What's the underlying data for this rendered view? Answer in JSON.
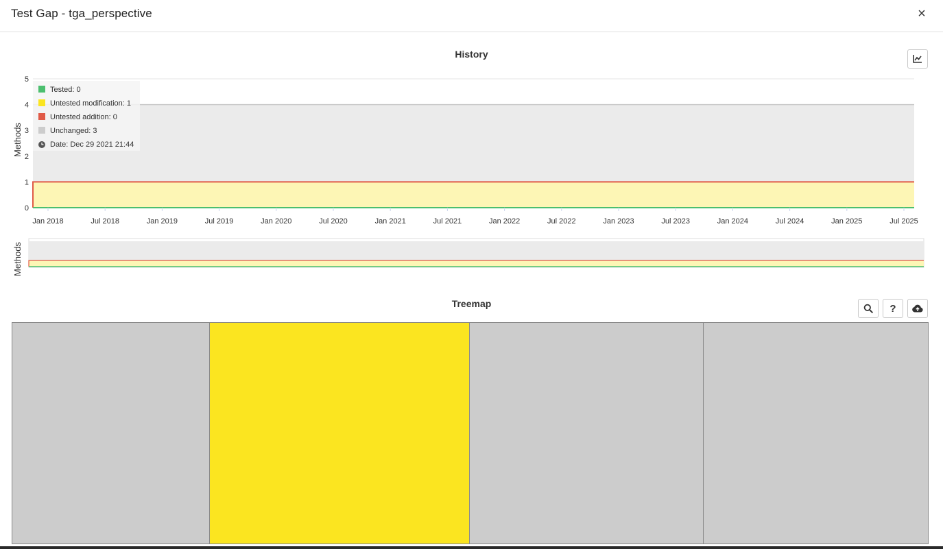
{
  "dialog": {
    "title": "Test Gap - tga_perspective",
    "close_icon": "×"
  },
  "history": {
    "title": "History",
    "tooltip": {
      "rows": [
        {
          "label": "Tested: 0",
          "color": "#4cbf6f"
        },
        {
          "label": "Untested modification: 1",
          "color": "#fbe520"
        },
        {
          "label": "Untested addition: 0",
          "color": "#e05a47"
        },
        {
          "label": "Unchanged: 3",
          "color": "#cccccc"
        }
      ],
      "date": "Date: Dec 29 2021 21:44"
    }
  },
  "chart_data": {
    "type": "area",
    "title": "History",
    "xlabel": "",
    "ylabel": "Methods",
    "ylim": [
      0,
      5
    ],
    "yticks": [
      "0",
      "1",
      "2",
      "3",
      "4",
      "5"
    ],
    "xticks": [
      "Jan 2018",
      "Jul 2018",
      "Jan 2019",
      "Jul 2019",
      "Jan 2020",
      "Jul 2020",
      "Jan 2021",
      "Jul 2021",
      "Jan 2022",
      "Jul 2022",
      "Jan 2023",
      "Jul 2023",
      "Jan 2024",
      "Jul 2024",
      "Jan 2025",
      "Jul 2025"
    ],
    "stacked": true,
    "grid": true,
    "series": [
      {
        "name": "Tested",
        "color": "#4cbf6f",
        "values": [
          0,
          0
        ]
      },
      {
        "name": "Untested modification",
        "color": "#fbe520",
        "values": [
          1,
          1
        ]
      },
      {
        "name": "Untested addition",
        "color": "#e05a47",
        "values": [
          0,
          0
        ]
      },
      {
        "name": "Unchanged",
        "color": "#cccccc",
        "values": [
          3,
          3
        ]
      }
    ],
    "x": [
      "Dec 29 2021 21:44"
    ],
    "navigator_ylabel": "Methods"
  },
  "treemap": {
    "title": "Treemap",
    "cells": [
      {
        "status": "unchanged",
        "color": "#cccccc",
        "weight": 288
      },
      {
        "status": "untested-modification",
        "color": "#fbe520",
        "weight": 380
      },
      {
        "status": "unchanged",
        "color": "#cccccc",
        "weight": 341
      },
      {
        "status": "unchanged",
        "color": "#cccccc",
        "weight": 327
      }
    ],
    "tools": [
      "search-icon",
      "help-icon",
      "cloud-upload-icon"
    ],
    "help_label": "?"
  }
}
